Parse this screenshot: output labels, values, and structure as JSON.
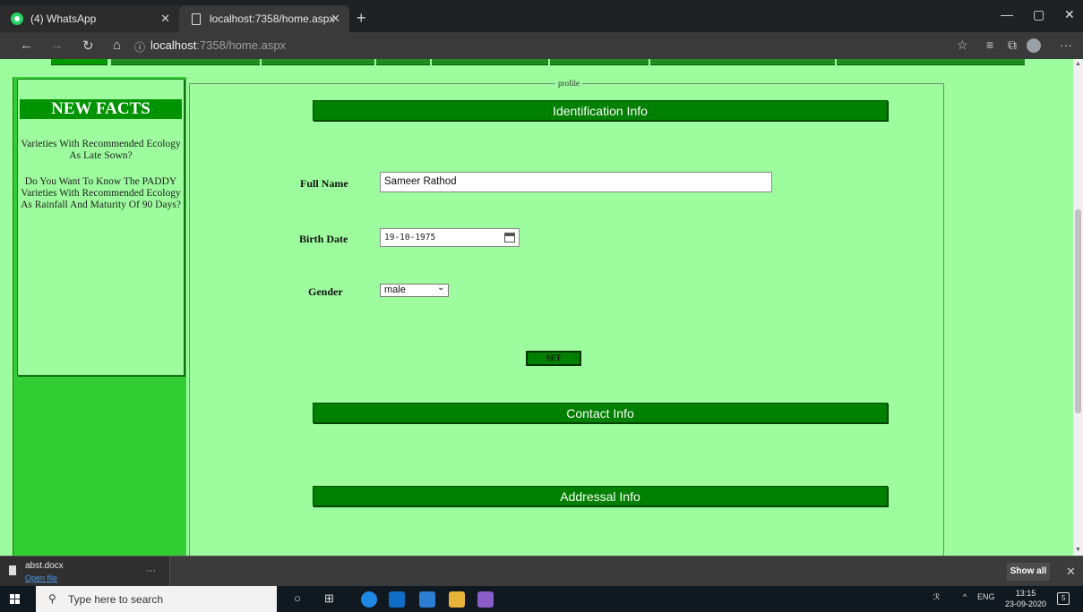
{
  "browser": {
    "tabs": [
      {
        "label": "(4) WhatsApp",
        "icon": "whatsapp-icon"
      },
      {
        "label": "localhost:7358/home.aspx",
        "icon": "page-icon"
      }
    ],
    "url_host": "localhost",
    "url_rest": ":7358/home.aspx"
  },
  "sidebar": {
    "title": "NEW FACTS",
    "facts": [
      "Varieties With Recommended Ecology As Late Sown?",
      "Do You Want To Know The PADDY Varieties With Recommended Ecology As Rainfall And Maturity Of 90 Days?"
    ]
  },
  "profile": {
    "legend": "profile",
    "sections": {
      "identification": "Identification Info",
      "contact": "Contact Info",
      "addressal": "Addressal Info"
    },
    "fullname_label": "Full Name",
    "fullname_value": "Sameer Rathod",
    "birthdate_label": "Birth Date",
    "birthdate_value": "19-10-1975",
    "gender_label": "Gender",
    "gender_value": "male",
    "set_button": "SET"
  },
  "downloads": {
    "file_name": "abst.docx",
    "open_link": "Open file",
    "show_all": "Show all"
  },
  "taskbar": {
    "search_placeholder": "Type here to search",
    "language": "ENG",
    "time": "13:15",
    "date": "23-09-2020",
    "notification_count": "5"
  },
  "colors": {
    "page_bg": "#9dfc9d",
    "section_bar": "#008000",
    "sidebar_green": "#32cd32"
  }
}
